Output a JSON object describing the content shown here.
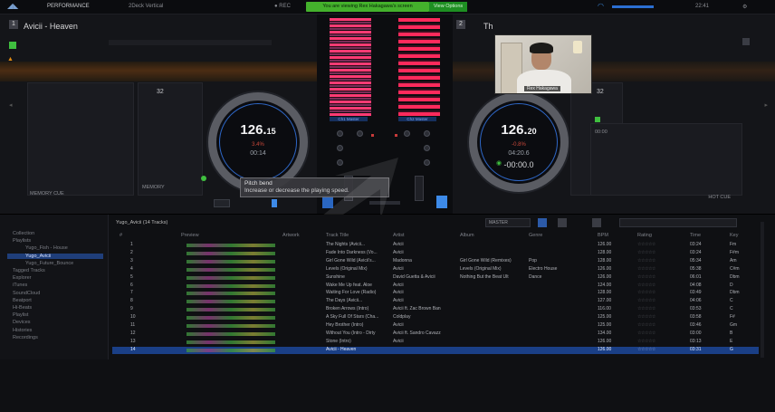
{
  "topbar": {
    "app_label": "PERFORMANCE",
    "deck_mode": "2Deck Vertical",
    "share_banner": "You are viewing Rex Hakagawa's screen",
    "view_options": "View Options",
    "clock": "22:41"
  },
  "deck_left": {
    "title": "Avicii - Heaven",
    "beat_count": "32",
    "bpm_main": "126.",
    "bpm_dec": "15",
    "pitch": "3.4%",
    "time": "00:14",
    "remaining": "",
    "memory_cue_label": "MEMORY CUE",
    "memory_label": "MEMORY"
  },
  "deck_right": {
    "title": "Th",
    "beat_count": "32",
    "bpm_main": "126.",
    "bpm_dec": "20",
    "pitch": "-0.8%",
    "time": "04:20.6",
    "remaining": "-00:00.0",
    "cue_time": "00:00",
    "hot_cue_label": "HOT CUE"
  },
  "mixer": {
    "left_label": "Ch1 Master",
    "right_label": "Ch2 Master"
  },
  "tooltip": {
    "title": "Pitch bend",
    "text": "Increase or decrease the playing speed."
  },
  "webcam": {
    "name": "Rex Hakagawa"
  },
  "browser": {
    "breadcrumb": "Yugo_Avicii (14 Tracks)",
    "sort_label": "MASTER",
    "sidebar_items": [
      "Collection",
      "Playlists",
      "Yugo_Fish - House",
      "Yugo_Avicii",
      "Yugo_Future_Bounce",
      "Tagged Tracks",
      "Explorer",
      "iTunes",
      "SoundCloud",
      "Beatport",
      "Hi-Beats",
      "Playlist",
      "Devices",
      "Histories",
      "Recordings"
    ],
    "columns": [
      "#",
      "Preview",
      "Artwork",
      "Track Title",
      "Artist",
      "Album",
      "Genre",
      "BPM",
      "Rating",
      "Time",
      "Key"
    ],
    "rows": [
      {
        "num": "1",
        "title": "The Nights (Avicii...",
        "artist": "Avicii",
        "album": "",
        "genre": "",
        "bpm": "126.00",
        "time": "03:24",
        "key": "Fm"
      },
      {
        "num": "2",
        "title": "Fade Into Darkness (Vo...",
        "artist": "Avicii",
        "album": "",
        "genre": "",
        "bpm": "128.00",
        "time": "03:24",
        "key": "F#m"
      },
      {
        "num": "3",
        "title": "Girl Gone Wild (Avicii's...",
        "artist": "Madonna",
        "album": "Girl Gone Wild (Remixes)",
        "genre": "Pop",
        "bpm": "128.00",
        "time": "05:34",
        "key": "Am"
      },
      {
        "num": "4",
        "title": "Levels (Original Mix)",
        "artist": "Avicii",
        "album": "Levels (Original Mix)",
        "genre": "Electro House",
        "bpm": "126.00",
        "time": "05:38",
        "key": "C#m"
      },
      {
        "num": "5",
        "title": "Sunshine",
        "artist": "David Guetta & Avicii",
        "album": "Nothing But the Beat Ult",
        "genre": "Dance",
        "bpm": "126.00",
        "time": "06:01",
        "key": "Dbm"
      },
      {
        "num": "6",
        "title": "Wake Me Up feat. Aloe",
        "artist": "Avicii",
        "album": "",
        "genre": "",
        "bpm": "124.00",
        "time": "04:08",
        "key": "D"
      },
      {
        "num": "7",
        "title": "Waiting For Love (Radio)",
        "artist": "Avicii",
        "album": "",
        "genre": "",
        "bpm": "128.00",
        "time": "03:49",
        "key": "Dbm"
      },
      {
        "num": "8",
        "title": "The Days (Avicii...",
        "artist": "Avicii",
        "album": "",
        "genre": "",
        "bpm": "127.00",
        "time": "04:06",
        "key": "C"
      },
      {
        "num": "9",
        "title": "Broken Arrows (Intro)",
        "artist": "Avicii ft. Zac Brown Ban",
        "album": "",
        "genre": "",
        "bpm": "116.00",
        "time": "03:53",
        "key": "C"
      },
      {
        "num": "10",
        "title": "A Sky Full Of Stars (Cha...",
        "artist": "Coldplay",
        "album": "",
        "genre": "",
        "bpm": "125.00",
        "time": "03:58",
        "key": "F#"
      },
      {
        "num": "11",
        "title": "Hey Brother (Intro)",
        "artist": "Avicii",
        "album": "",
        "genre": "",
        "bpm": "125.00",
        "time": "03:46",
        "key": "Gm"
      },
      {
        "num": "12",
        "title": "Without You (Intro - Dirty",
        "artist": "Avicii ft. Sandro Cavazz",
        "album": "",
        "genre": "",
        "bpm": "134.00",
        "time": "03:00",
        "key": "B"
      },
      {
        "num": "13",
        "title": "Stone (Intro)",
        "artist": "Avicii",
        "album": "",
        "genre": "",
        "bpm": "126.00",
        "time": "03:13",
        "key": "E"
      },
      {
        "num": "14",
        "title": "Avicii - Heaven",
        "artist": "",
        "album": "",
        "genre": "",
        "bpm": "126.00",
        "time": "03:31",
        "key": "G"
      }
    ],
    "selected_row": 13
  }
}
